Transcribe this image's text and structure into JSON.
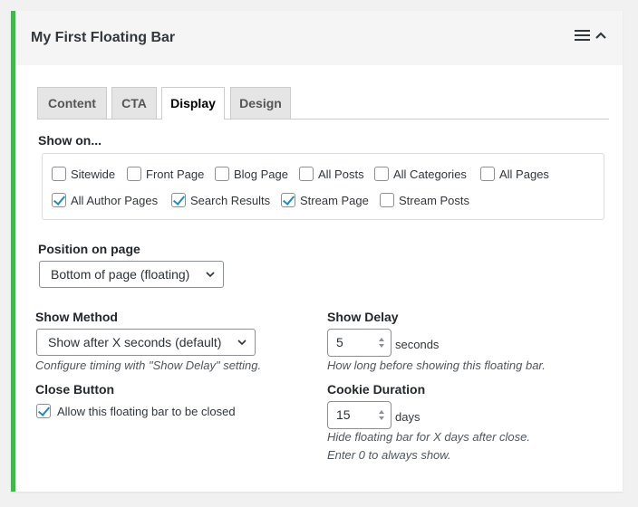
{
  "panel": {
    "title": "My First Floating Bar",
    "accent_color": "#46b450"
  },
  "tabs": [
    {
      "label": "Content"
    },
    {
      "label": "CTA"
    },
    {
      "label": "Display",
      "active": true
    },
    {
      "label": "Design"
    }
  ],
  "show_on": {
    "label": "Show on...",
    "options": [
      {
        "label": "Sitewide",
        "checked": false
      },
      {
        "label": "Front Page",
        "checked": false
      },
      {
        "label": "Blog Page",
        "checked": false
      },
      {
        "label": "All Posts",
        "checked": false
      },
      {
        "label": "All Categories",
        "checked": false
      },
      {
        "label": "All Pages",
        "checked": false
      },
      {
        "label": "All Author Pages",
        "checked": true
      },
      {
        "label": "Search Results",
        "checked": true
      },
      {
        "label": "Stream Page",
        "checked": true
      },
      {
        "label": "Stream Posts",
        "checked": false
      }
    ]
  },
  "position": {
    "label": "Position on page",
    "value": "Bottom of page (floating)"
  },
  "show_method": {
    "label": "Show Method",
    "value": "Show after X seconds (default)",
    "help": "Configure timing with \"Show Delay\" setting."
  },
  "show_delay": {
    "label": "Show Delay",
    "value": "5",
    "unit": "seconds",
    "help": "How long before showing this floating bar."
  },
  "close_button": {
    "label": "Close Button",
    "checkbox_label": "Allow this floating bar to be closed",
    "checked": true
  },
  "cookie_duration": {
    "label": "Cookie Duration",
    "value": "15",
    "unit": "days",
    "help_line1": "Hide floating bar for X days after close.",
    "help_line2": "Enter 0 to always show."
  },
  "icons": {
    "menu": "hamburger-menu-icon",
    "collapse": "chevron-up-icon",
    "select_caret": "chevron-down-icon",
    "number_spinner": "spinner-arrows-icon",
    "checkmark_color": "#1e8cbe"
  }
}
